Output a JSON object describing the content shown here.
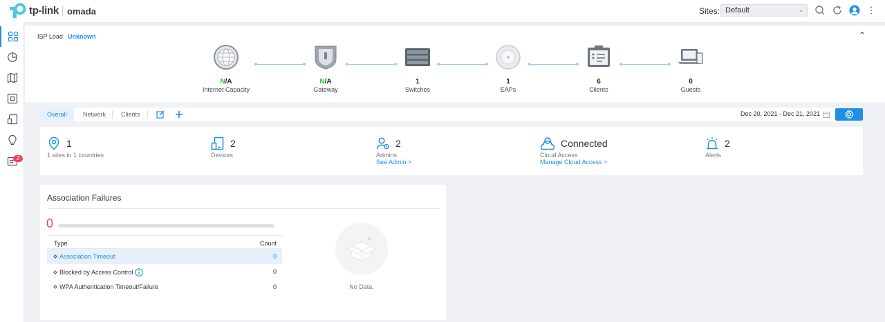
{
  "header": {
    "brand": "tp-link",
    "product": "omada",
    "sites_label": "Sites:",
    "sites_value": "Default"
  },
  "sidebar": {
    "items": [
      {
        "icon": "dashboard-icon",
        "active": true
      },
      {
        "icon": "statistics-icon"
      },
      {
        "icon": "map-icon"
      },
      {
        "icon": "devices-icon"
      },
      {
        "icon": "clients-icon"
      },
      {
        "icon": "insight-icon"
      },
      {
        "icon": "logs-icon",
        "badge": "2"
      }
    ]
  },
  "isp": {
    "label": "ISP Load",
    "value": "Unknown"
  },
  "topology": [
    {
      "value": "N/A",
      "name": "Internet Capacity",
      "icon": "globe-icon"
    },
    {
      "value": "N/A",
      "name": "Gateway",
      "icon": "gateway-shield-icon"
    },
    {
      "value": "1",
      "name": "Switches",
      "icon": "switch-icon"
    },
    {
      "value": "1",
      "name": "EAPs",
      "icon": "access-point-icon"
    },
    {
      "value": "6",
      "name": "Clients",
      "icon": "clipboard-icon"
    },
    {
      "value": "0",
      "name": "Guests",
      "icon": "laptop-icon"
    }
  ],
  "tabs": {
    "items": [
      "Overall",
      "Network",
      "Clients"
    ],
    "active": "Overall",
    "date_range": "Dec 20, 2021 - Dec 21, 2021"
  },
  "stats": [
    {
      "icon": "location-pin-icon",
      "value": "1",
      "label": "1 sites in 1 countries",
      "link": ""
    },
    {
      "icon": "devices-icon",
      "value": "2",
      "label": "Devices",
      "link": ""
    },
    {
      "icon": "admin-icon",
      "value": "2",
      "label": "Admins",
      "link": "See Admin >"
    },
    {
      "icon": "cloud-user-icon",
      "value": "Connected",
      "label": "Cloud Access",
      "link": "Manage Cloud Access >"
    },
    {
      "icon": "alert-siren-icon",
      "value": "2",
      "label": "Alerts",
      "link": ""
    }
  ],
  "association_failures": {
    "title": "Association Failures",
    "total": "0",
    "table": {
      "headers": [
        "Type",
        "Count"
      ],
      "rows": [
        {
          "type": "Association Timeout",
          "count": "0",
          "highlighted": true
        },
        {
          "type": "Blocked by Access Control",
          "count": "0",
          "info": true
        },
        {
          "type": "WPA Authentication Timeout/Failure",
          "count": "0"
        }
      ]
    },
    "empty_text": "No Data."
  },
  "colors": {
    "accent": "#1e8ee6",
    "danger": "#f5405b",
    "success": "#2dc437"
  }
}
